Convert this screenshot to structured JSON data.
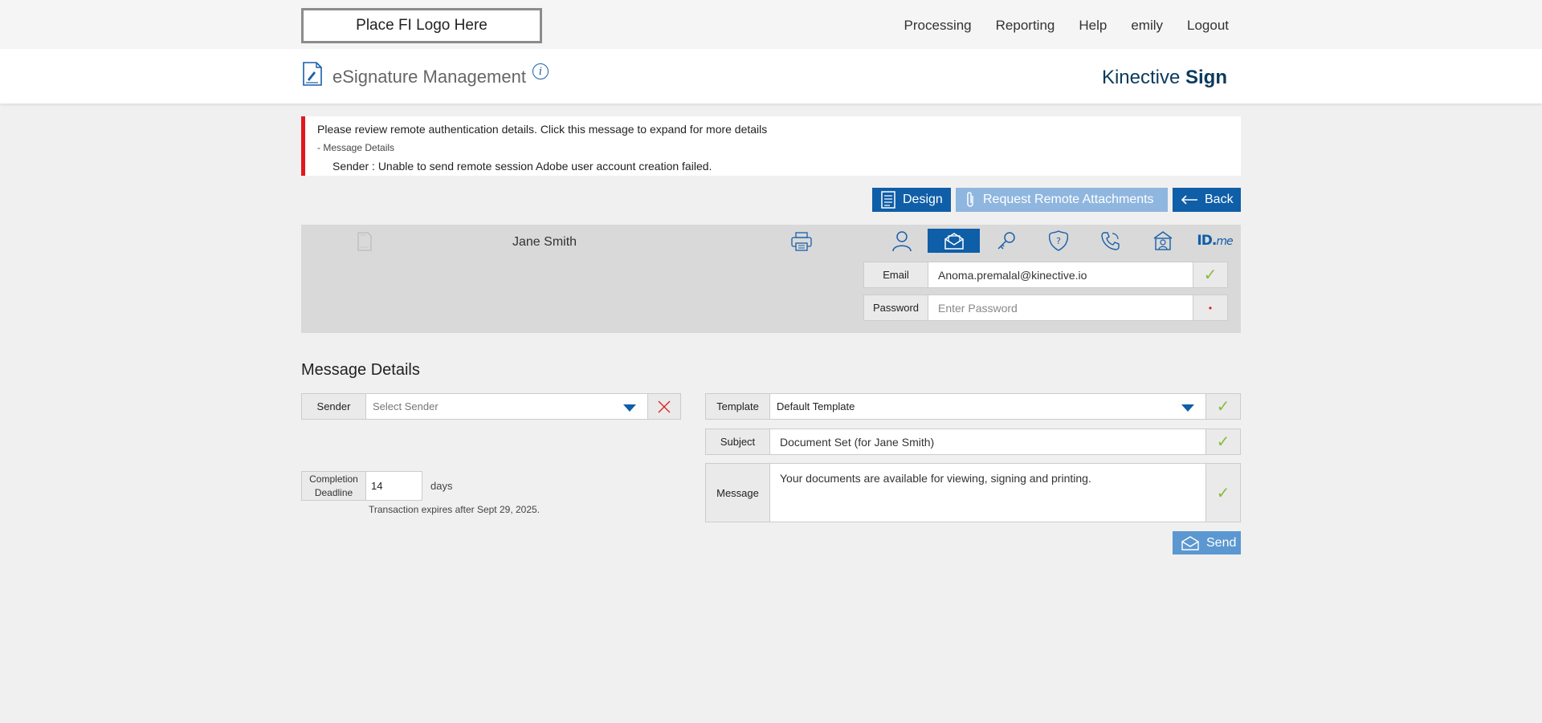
{
  "topbar": {
    "logo_text": "Place FI Logo Here",
    "nav": [
      "Processing",
      "Reporting",
      "Help",
      "emily",
      "Logout"
    ]
  },
  "header": {
    "title": "eSignature Management",
    "info_glyph": "i",
    "brand_light": "Kinective ",
    "brand_bold": "Sign"
  },
  "alert": {
    "headline": "Please review remote authentication details. Click this message to expand for more details",
    "toggle": "- Message Details",
    "detail": "Sender :  Unable to send remote session Adobe user account creation failed.",
    "accent_color": "#e0191c"
  },
  "actions": {
    "design": "Design",
    "request": "Request Remote Attachments",
    "back": "Back"
  },
  "signer": {
    "name": "Jane Smith",
    "auth_icons": [
      "person-icon",
      "email-icon",
      "key-icon",
      "shield-question-icon",
      "phone-icon",
      "bank-icon",
      "idme-icon"
    ],
    "active_auth": "email-icon",
    "idme_label_a": "ID.",
    "idme_label_b": "me",
    "email_label": "Email",
    "email_value": "Anoma.premalal@kinective.io",
    "password_label": "Password",
    "password_placeholder": "Enter Password"
  },
  "message": {
    "section_title": "Message Details",
    "sender_label": "Sender",
    "sender_placeholder": "Select Sender",
    "template_label": "Template",
    "template_value": "Default Template",
    "subject_label": "Subject",
    "subject_value": "Document Set (for Jane Smith)",
    "message_label": "Message",
    "message_value": "Your documents are available for viewing, signing and printing.",
    "deadline_label": "Completion Deadline",
    "deadline_value": "14",
    "deadline_unit": "days",
    "expires_text": "Transaction expires after Sept 29, 2025.",
    "send": "Send"
  },
  "colors": {
    "primary": "#0f5ea8",
    "primary_disabled": "#8fb6df",
    "send": "#5b97d0",
    "success": "#8abb3f",
    "error": "#e0191c"
  }
}
